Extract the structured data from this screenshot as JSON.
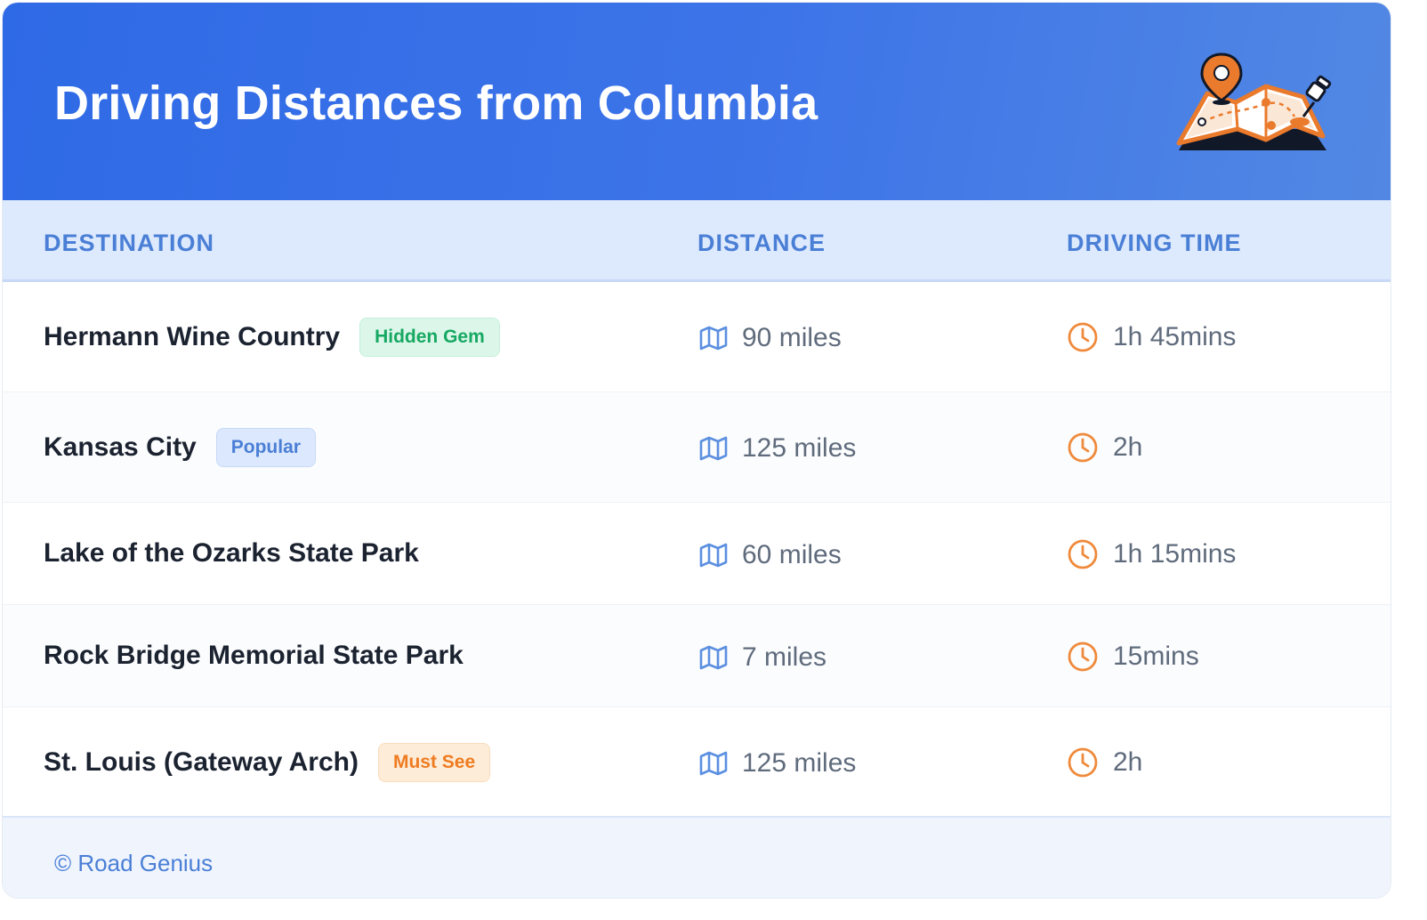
{
  "header": {
    "title": "Driving Distances from Columbia",
    "illustration": "map-with-pins-icon"
  },
  "table": {
    "columns": [
      "DESTINATION",
      "DISTANCE",
      "DRIVING TIME"
    ],
    "rows": [
      {
        "destination": "Hermann Wine Country",
        "badge": "Hidden Gem",
        "badge_color": "#17a863",
        "distance": "90 miles",
        "time": "1h 45mins"
      },
      {
        "destination": "Kansas City",
        "badge": "Popular",
        "badge_color": "#4a7fd6",
        "distance": "125 miles",
        "time": "2h"
      },
      {
        "destination": "Lake of the Ozarks State Park",
        "badge": "",
        "distance": "60 miles",
        "time": "1h 15mins"
      },
      {
        "destination": "Rock Bridge Memorial State Park",
        "badge": "",
        "distance": "7 miles",
        "time": "15mins"
      },
      {
        "destination": "St. Louis (Gateway Arch)",
        "badge": "Must See",
        "badge_color": "#ef7b20",
        "distance": "125 miles",
        "time": "2h"
      }
    ],
    "distance_icon": "map-icon",
    "time_icon": "clock-icon"
  },
  "footer": {
    "text": "© Road Genius"
  },
  "colors": {
    "header_bg": "#2f6ae6",
    "accent_blue": "#4a7fd6",
    "accent_orange": "#ef8a3c",
    "text_dark": "#1b2230",
    "text_muted": "#5f6b7c"
  }
}
